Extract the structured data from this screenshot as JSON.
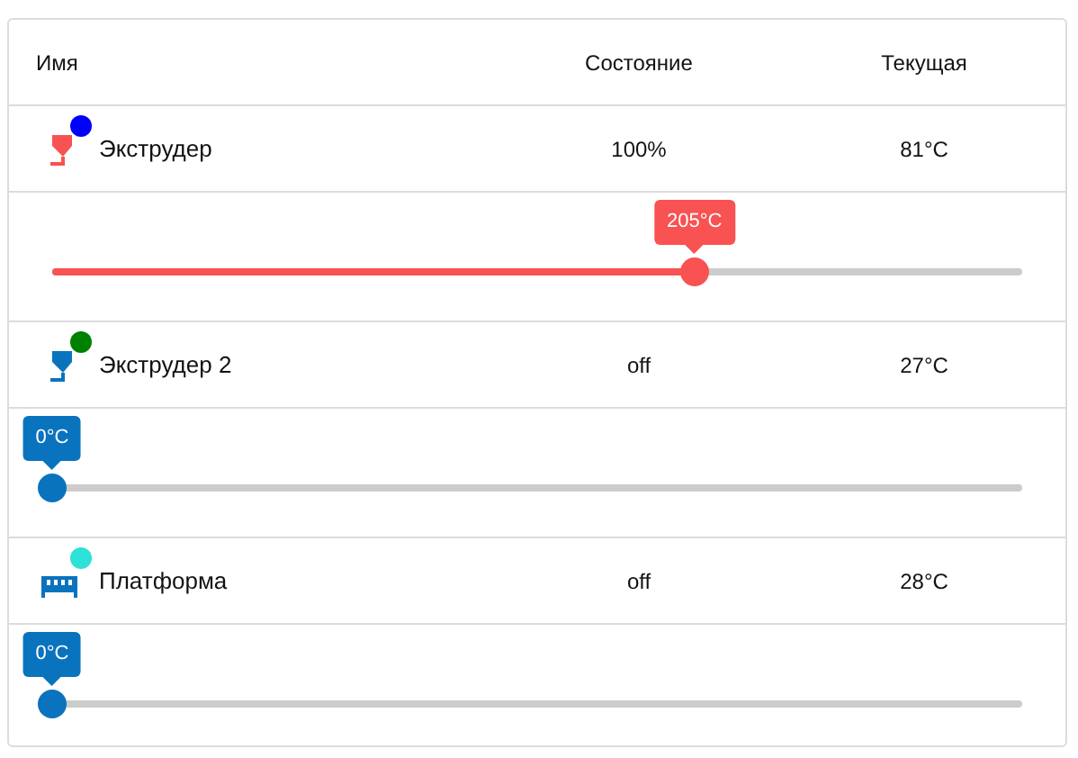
{
  "table": {
    "columns": [
      "Имя",
      "Состояние",
      "Текущая"
    ],
    "rows": [
      {
        "name": "Экструдер",
        "kind": "extruder",
        "color": "#0000ff",
        "heating": true,
        "state": "100%",
        "current": "81°C",
        "target": "205°C",
        "level": 0.662
      },
      {
        "name": "Экструдер 2",
        "kind": "extruder",
        "color": "#008000",
        "heating": false,
        "state": "off",
        "current": "27°C",
        "target": "0°C",
        "level": 0
      },
      {
        "name": "Платформа",
        "kind": "bed",
        "color": "#2de0d8",
        "heating": false,
        "state": "off",
        "current": "28°C",
        "target": "0°C",
        "level": 0
      }
    ]
  }
}
